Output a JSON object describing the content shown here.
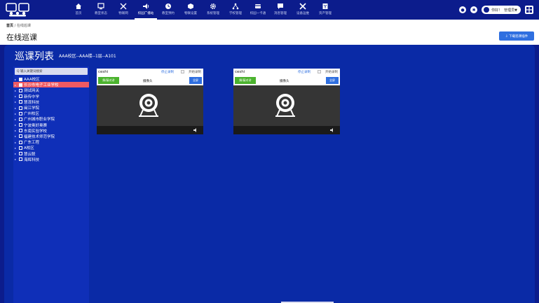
{
  "nav": {
    "items": [
      {
        "label": "首页",
        "icon": "home-icon"
      },
      {
        "label": "教室状态",
        "icon": "monitor-icon"
      },
      {
        "label": "物联网",
        "icon": "iot-icon"
      },
      {
        "label": "校园广播站",
        "icon": "broadcast-icon",
        "active": true
      },
      {
        "label": "教室预约",
        "icon": "clock-icon"
      },
      {
        "label": "物联设置",
        "icon": "cube-icon"
      },
      {
        "label": "系统管理",
        "icon": "gear-icon"
      },
      {
        "label": "学校管理",
        "icon": "org-icon"
      },
      {
        "label": "校园一卡通",
        "icon": "card-icon"
      },
      {
        "label": "消息管理",
        "icon": "message-icon"
      },
      {
        "label": "设备运维",
        "icon": "tools-icon"
      },
      {
        "label": "资产管理",
        "icon": "asset-icon"
      }
    ]
  },
  "user": {
    "greeting": "你好！",
    "name": "管理员▼"
  },
  "breadcrumb": {
    "home": "首页",
    "sep": "/",
    "current": "在线巡课"
  },
  "page": {
    "title": "在线巡课",
    "download_label": "⇩ 下载巡课插件"
  },
  "panel": {
    "title": "巡课列表",
    "location": "AAA校区--AAA楼--1层--A101"
  },
  "tree": {
    "search_placeholder": "Q 输入关键词搜索",
    "items": [
      {
        "label": "AAA校区",
        "state": "checked"
      },
      {
        "label": "长沙市电子工业学校",
        "state": "selected"
      },
      {
        "label": "测试网关"
      },
      {
        "label": "新传中学"
      },
      {
        "label": "慧茂科技"
      },
      {
        "label": "闽江学院"
      },
      {
        "label": "广州校区"
      },
      {
        "label": "广州城市职业学院"
      },
      {
        "label": "宁波奥好奥赛"
      },
      {
        "label": "东南实验学校"
      },
      {
        "label": "福建技术师范学院"
      },
      {
        "label": "广东工程"
      },
      {
        "label": "A校区"
      },
      {
        "label": "慧云联"
      },
      {
        "label": "海辉科技"
      }
    ]
  },
  "cards": [
    {
      "caption": "ceshi",
      "stop": "停止录制",
      "record": "开始录制",
      "talk": "解/蔽对讲",
      "camera": "摄像头",
      "fullscreen": "全屏"
    },
    {
      "caption": "ceshi",
      "stop": "停止录制",
      "record": "开始录制",
      "talk": "解/蔽对讲",
      "camera": "摄像头",
      "fullscreen": "全屏"
    }
  ]
}
